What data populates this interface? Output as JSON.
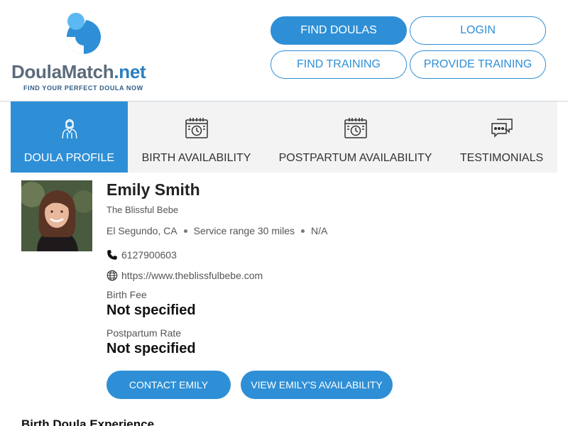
{
  "header": {
    "logo": {
      "name_main": "DoulaMatch",
      "name_tld": ".net",
      "tagline": "FIND YOUR PERFECT DOULA NOW"
    },
    "nav": {
      "find_doulas": "FIND DOULAS",
      "login": "LOGIN",
      "find_training": "FIND TRAINING",
      "provide_training": "PROVIDE TRAINING"
    }
  },
  "tabs": [
    {
      "label": "DOULA PROFILE",
      "icon": "doula-person-icon",
      "active": true
    },
    {
      "label": "BIRTH AVAILABILITY",
      "icon": "calendar-clock-icon",
      "active": false
    },
    {
      "label": "POSTPARTUM AVAILABILITY",
      "icon": "calendar-clock-icon",
      "active": false
    },
    {
      "label": "TESTIMONIALS",
      "icon": "chat-bubbles-icon",
      "active": false
    }
  ],
  "profile": {
    "name": "Emily Smith",
    "business": "The Blissful Bebe",
    "location": "El Segundo, CA",
    "service_range": "Service range 30 miles",
    "extra": "N/A",
    "phone": "6127900603",
    "website": "https://www.theblissfulbebe.com",
    "birth_fee_label": "Birth Fee",
    "birth_fee_value": "Not specified",
    "postpartum_rate_label": "Postpartum Rate",
    "postpartum_rate_value": "Not specified",
    "contact_button": "CONTACT EMILY",
    "availability_button": "VIEW EMILY'S AVAILABILITY"
  },
  "sections": {
    "birth_experience_title": "Birth Doula Experience"
  },
  "colors": {
    "accent": "#2e8fd6",
    "logo_light_blue": "#5bb8f0",
    "text_gray": "#555555"
  }
}
